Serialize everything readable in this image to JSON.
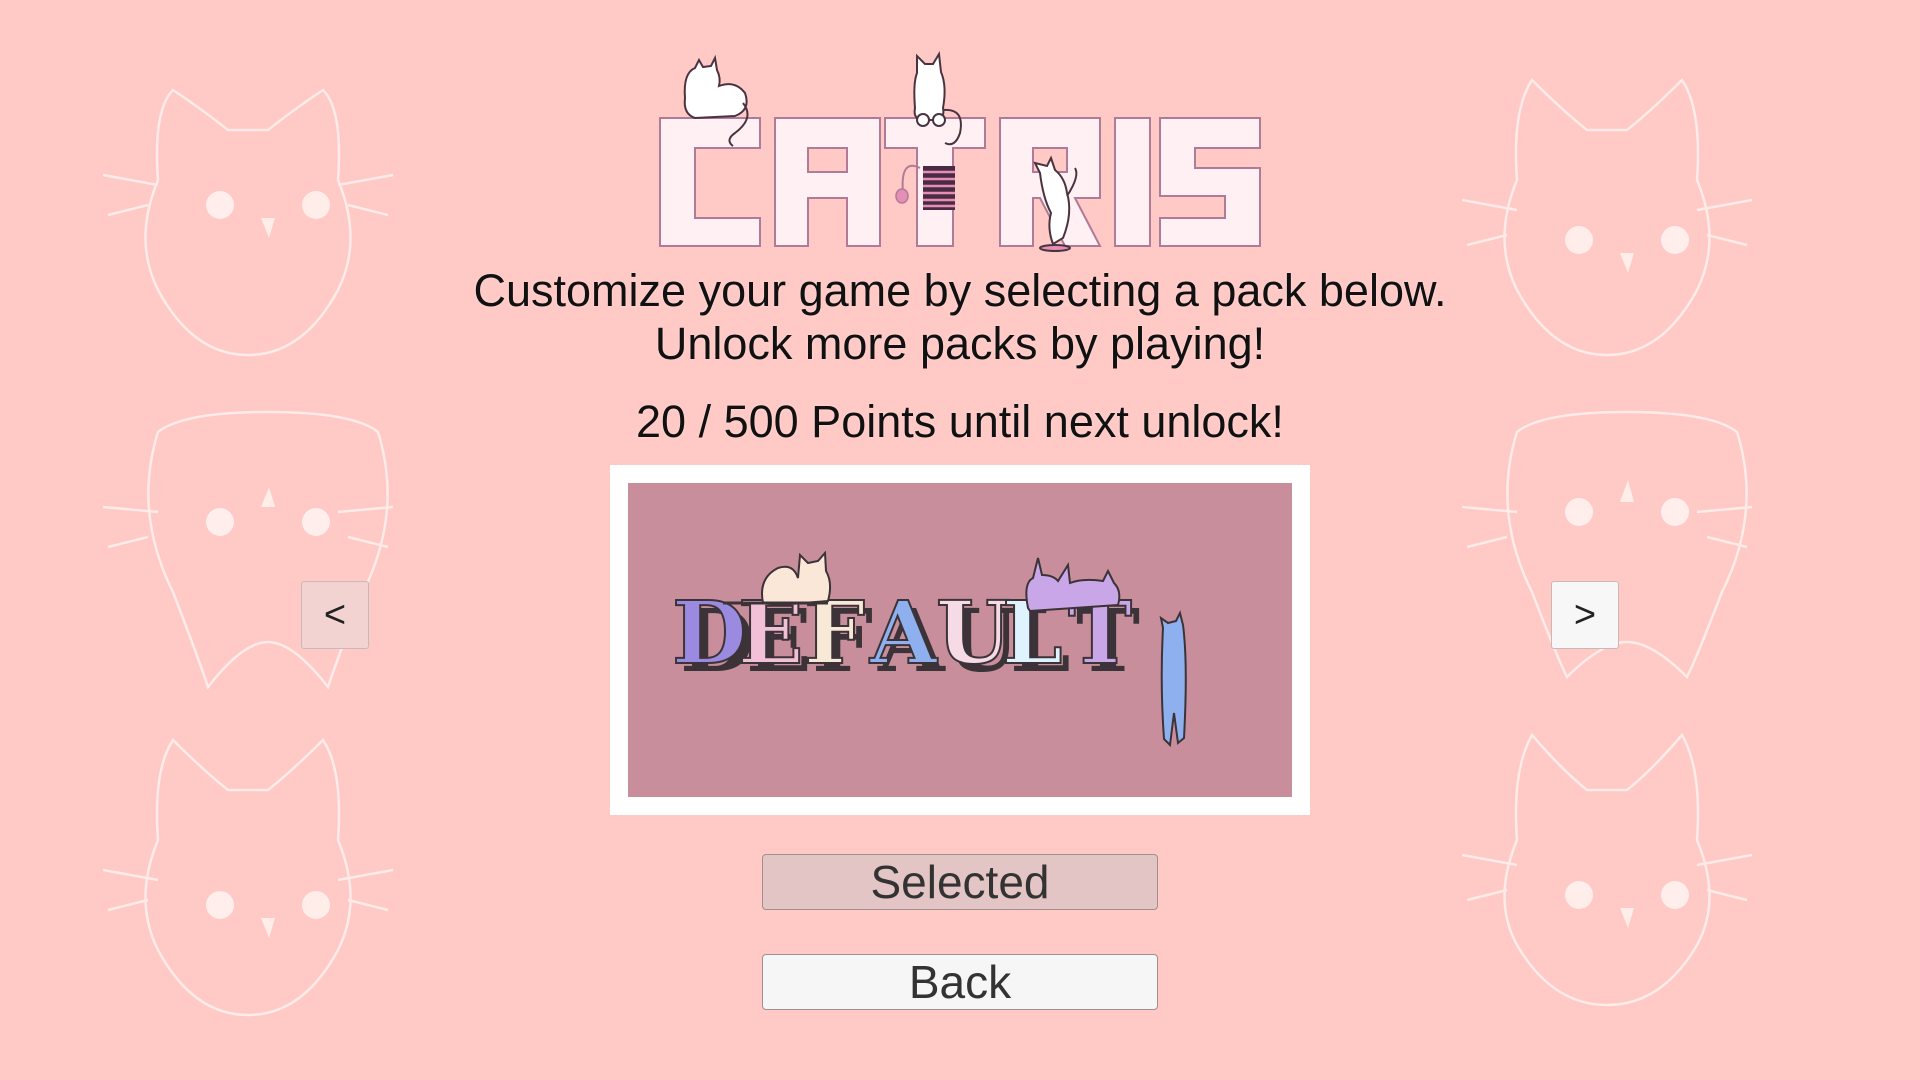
{
  "title": "CATRIS",
  "instructions": {
    "line1": "Customize your game by selecting a pack below.",
    "line2": "Unlock more packs by playing!"
  },
  "progress": {
    "text": "20 / 500 Points until next unlock!",
    "current": 20,
    "target": 500
  },
  "pack": {
    "name": "DEFAULT"
  },
  "navigation": {
    "prev_label": "<",
    "next_label": ">"
  },
  "buttons": {
    "selected_label": "Selected",
    "back_label": "Back"
  },
  "colors": {
    "background": "#ffc9c6",
    "preview_background": "#c98e9b",
    "letters": [
      "#9b8be0",
      "#f2c1d8",
      "#f8e8d6",
      "#8fb0ee",
      "#f6dbe6",
      "#dff3ff",
      "#c9a6e8"
    ]
  }
}
